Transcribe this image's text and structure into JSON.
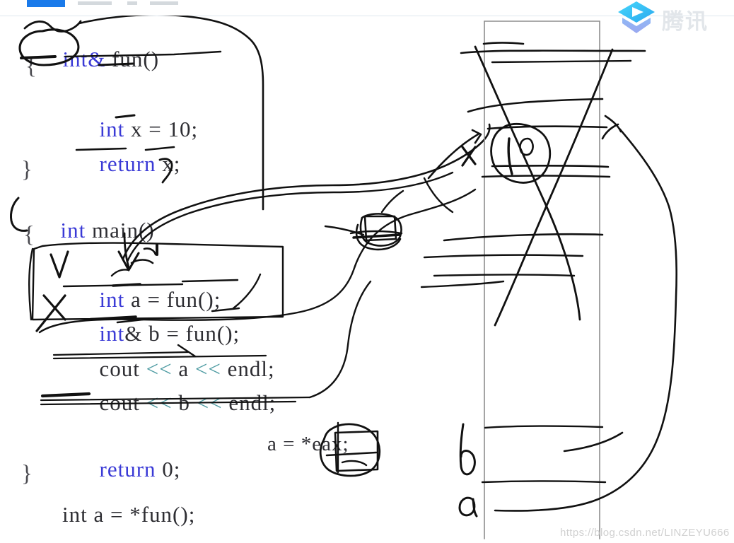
{
  "player": {
    "app_name": "Tencent Video",
    "logo_name": "tencent-video-logo",
    "brand_text": "腾讯",
    "brand_color": "#38c6f4",
    "progress_color": "#1a7aea"
  },
  "watermark": {
    "url_text": "https://blog.csdn.net/LINZEYU666"
  },
  "code": {
    "language": "cpp",
    "keyword_color": "#3a3ad6",
    "operator_color": "#4f9ca3",
    "text_color": "#2e2e33",
    "lines": [
      {
        "id": "fn-signature",
        "parts": [
          {
            "t": "int&",
            "c": "kw"
          },
          {
            "t": " fun()",
            "c": "pl"
          }
        ]
      },
      {
        "id": "fn-open-brace",
        "parts": [
          {
            "t": "{",
            "c": "br"
          }
        ]
      },
      {
        "id": "decl-x",
        "parts": [
          {
            "t": "int",
            "c": "kw"
          },
          {
            "t": " x = 10;",
            "c": "pl"
          }
        ]
      },
      {
        "id": "return-x",
        "parts": [
          {
            "t": "return",
            "c": "kw"
          },
          {
            "t": " x;",
            "c": "pl"
          }
        ]
      },
      {
        "id": "fn-close-brace",
        "parts": [
          {
            "t": "}",
            "c": "br"
          }
        ]
      },
      {
        "id": "main-signature",
        "parts": [
          {
            "t": "int",
            "c": "kw"
          },
          {
            "t": " main()",
            "c": "pl"
          }
        ]
      },
      {
        "id": "main-open-brace",
        "parts": [
          {
            "t": "{",
            "c": "br"
          }
        ]
      },
      {
        "id": "decl-a",
        "parts": [
          {
            "t": "int",
            "c": "kw"
          },
          {
            "t": " a = fun();",
            "c": "pl"
          }
        ]
      },
      {
        "id": "decl-b",
        "parts": [
          {
            "t": "int",
            "c": "kw"
          },
          {
            "t": "& b = fun();",
            "c": "pl"
          }
        ]
      },
      {
        "id": "cout-a",
        "parts": [
          {
            "t": "cout ",
            "c": "pl"
          },
          {
            "t": "<<",
            "c": "op"
          },
          {
            "t": " a ",
            "c": "pl"
          },
          {
            "t": "<<",
            "c": "op"
          },
          {
            "t": " endl;",
            "c": "pl"
          }
        ]
      },
      {
        "id": "cout-b",
        "parts": [
          {
            "t": "cout ",
            "c": "pl"
          },
          {
            "t": "<<",
            "c": "op"
          },
          {
            "t": " b ",
            "c": "pl"
          },
          {
            "t": "<<",
            "c": "op"
          },
          {
            "t": " endl;",
            "c": "pl"
          }
        ]
      },
      {
        "id": "return-0",
        "parts": [
          {
            "t": "return",
            "c": "kw"
          },
          {
            "t": " 0;",
            "c": "pl"
          }
        ]
      },
      {
        "id": "main-close-brace",
        "parts": [
          {
            "t": "}",
            "c": "br"
          }
        ]
      },
      {
        "id": "decl-a-deref",
        "parts": [
          {
            "t": "int a = *fun();",
            "c": "pl"
          }
        ]
      }
    ],
    "line_text": {
      "fn_signature": "int& fun()",
      "fn_open_brace": "{",
      "decl_x": "int x = 10;",
      "return_x": "return x;",
      "fn_close_brace": "}",
      "main_signature": "int main()",
      "main_open_brace": "{",
      "decl_a": "int a = fun();",
      "decl_b": "int& b = fun();",
      "cout_a": "cout << a << endl;",
      "cout_b": "cout << b << endl;",
      "return_0": "return 0;",
      "main_close_brace": "}",
      "decl_a_deref": "int a = *fun();"
    },
    "side_note": "a = *eax;"
  },
  "annotations": {
    "check_mark": "✓",
    "cross_mark": "✗",
    "stack_value": "10",
    "label_b": "b",
    "label_a": "a",
    "ink_color": "#111111",
    "box_color": "#8d8d8d"
  }
}
